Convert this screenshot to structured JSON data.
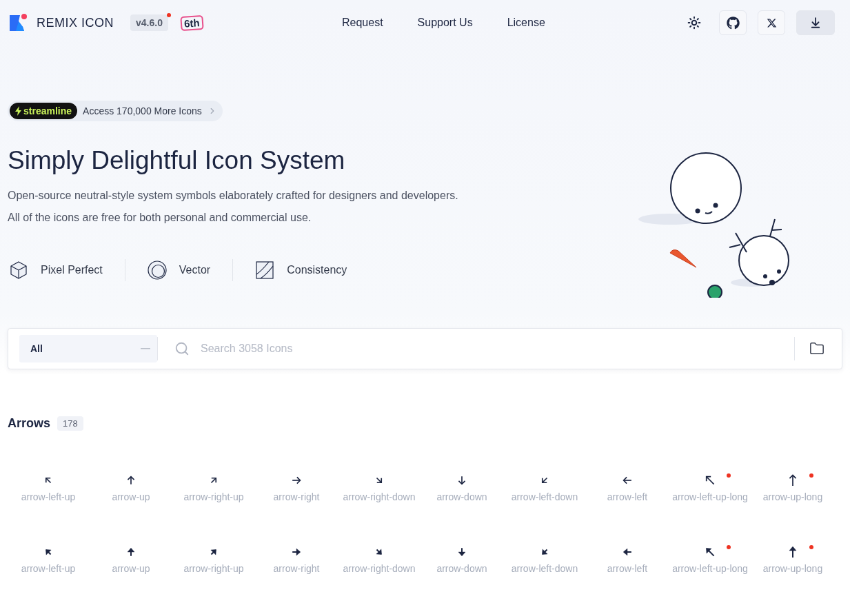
{
  "header": {
    "brand": "REMIX ICON",
    "version": "v4.6.0",
    "anniversary": "6th",
    "nav": [
      {
        "label": "Request"
      },
      {
        "label": "Support Us"
      },
      {
        "label": "License"
      }
    ]
  },
  "hero": {
    "promo": {
      "brand": "streamline",
      "text": "Access 170,000 More Icons"
    },
    "title": "Simply Delightful Icon System",
    "lines": [
      "Open-source neutral-style system symbols elaborately crafted for designers and developers.",
      "All of the icons are free for both personal and commercial use."
    ],
    "features": [
      {
        "kind": "cube",
        "label": "Pixel Perfect"
      },
      {
        "kind": "circle",
        "label": "Vector"
      },
      {
        "kind": "square",
        "label": "Consistency"
      }
    ]
  },
  "search": {
    "category": "All",
    "placeholder": "Search 3058 Icons"
  },
  "section": {
    "title": "Arrows",
    "count": "178",
    "rows": [
      {
        "kind": "line",
        "icons": [
          {
            "name": "arrow-left-up",
            "new": false
          },
          {
            "name": "arrow-up",
            "new": false
          },
          {
            "name": "arrow-right-up",
            "new": false
          },
          {
            "name": "arrow-right",
            "new": false
          },
          {
            "name": "arrow-right-down",
            "new": false
          },
          {
            "name": "arrow-down",
            "new": false
          },
          {
            "name": "arrow-left-down",
            "new": false
          },
          {
            "name": "arrow-left",
            "new": false
          },
          {
            "name": "arrow-left-up-long",
            "new": true
          },
          {
            "name": "arrow-up-long",
            "new": true
          }
        ]
      },
      {
        "kind": "fill",
        "icons": [
          {
            "name": "arrow-left-up",
            "new": false
          },
          {
            "name": "arrow-up",
            "new": false
          },
          {
            "name": "arrow-right-up",
            "new": false
          },
          {
            "name": "arrow-right",
            "new": false
          },
          {
            "name": "arrow-right-down",
            "new": false
          },
          {
            "name": "arrow-down",
            "new": false
          },
          {
            "name": "arrow-left-down",
            "new": false
          },
          {
            "name": "arrow-left",
            "new": false
          },
          {
            "name": "arrow-left-up-long",
            "new": true
          },
          {
            "name": "arrow-up-long",
            "new": true
          }
        ]
      }
    ]
  }
}
